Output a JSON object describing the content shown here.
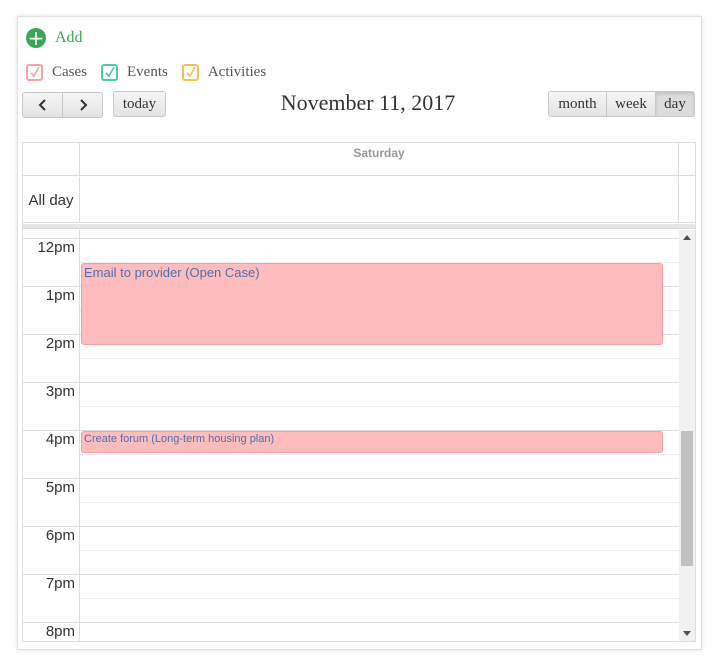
{
  "add": {
    "label": "Add",
    "icon": "plus-circle-icon",
    "color": "#3aa65a"
  },
  "filters": [
    {
      "label": "Cases",
      "checked": true,
      "color": "#f4a3a3"
    },
    {
      "label": "Events",
      "checked": true,
      "color": "#4ec9b0"
    },
    {
      "label": "Activities",
      "checked": true,
      "color": "#f2c14e"
    }
  ],
  "toolbar": {
    "prev_icon": "chevron-left-icon",
    "next_icon": "chevron-right-icon",
    "today_label": "today",
    "title": "November 11, 2017",
    "views": [
      {
        "label": "month",
        "active": false
      },
      {
        "label": "week",
        "active": false
      },
      {
        "label": "day",
        "active": true
      }
    ]
  },
  "calendar": {
    "day_header": "Saturday",
    "all_day_label": "All day",
    "times": [
      "12pm",
      "1pm",
      "2pm",
      "3pm",
      "4pm",
      "5pm",
      "6pm",
      "7pm",
      "8pm"
    ],
    "events": [
      {
        "title": "Email to provider (Open Case)",
        "start": "12:30pm",
        "end": "2:15pm",
        "color": "#ffbcbc"
      },
      {
        "title": "Create forum (Long-term housing plan)",
        "start": "4:00pm",
        "end": "4:30pm",
        "color": "#ffbcbc"
      }
    ]
  }
}
